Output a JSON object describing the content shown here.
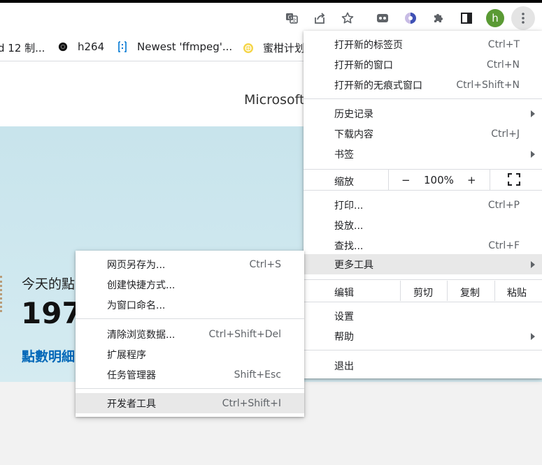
{
  "toolbar": {
    "icons": [
      "translate-icon",
      "share-icon",
      "bookmark-star-icon",
      "extension-game-icon",
      "extension-halo-icon",
      "extensions-puzzle-icon",
      "side-panel-icon",
      "profile-avatar",
      "kebab-menu-icon"
    ],
    "avatar_letter": "h",
    "avatar_color": "#5a9a34"
  },
  "bookmarks": [
    {
      "label": "d 12 制...",
      "icon": "none"
    },
    {
      "label": "h264",
      "icon": "dark-circle-icon"
    },
    {
      "label": "Newest 'ffmpeg'...",
      "icon": "stackoverflow-icon"
    },
    {
      "label": "蜜柑计划",
      "icon": "lemon-icon"
    }
  ],
  "page": {
    "header_title": "Microsoft",
    "today_label": "今天的點",
    "points_value": "197",
    "detail_link": "點數明細",
    "link_color": "#0067b8"
  },
  "main_menu": {
    "new_tab": {
      "label": "打开新的标签页",
      "shortcut": "Ctrl+T"
    },
    "new_window": {
      "label": "打开新的窗口",
      "shortcut": "Ctrl+N"
    },
    "incognito": {
      "label": "打开新的无痕式窗口",
      "shortcut": "Ctrl+Shift+N"
    },
    "history": {
      "label": "历史记录"
    },
    "downloads": {
      "label": "下载内容",
      "shortcut": "Ctrl+J"
    },
    "bookmarks": {
      "label": "书签"
    },
    "zoom": {
      "label": "缩放",
      "minus": "−",
      "value": "100%",
      "plus": "+"
    },
    "print": {
      "label": "打印...",
      "shortcut": "Ctrl+P"
    },
    "cast": {
      "label": "投放..."
    },
    "find": {
      "label": "查找...",
      "shortcut": "Ctrl+F"
    },
    "more_tools": {
      "label": "更多工具"
    },
    "edit": {
      "label": "编辑",
      "cut": "剪切",
      "copy": "复制",
      "paste": "粘贴"
    },
    "settings": {
      "label": "设置"
    },
    "help": {
      "label": "帮助"
    },
    "exit": {
      "label": "退出"
    }
  },
  "sub_menu": {
    "save_page": {
      "label": "网页另存为...",
      "shortcut": "Ctrl+S"
    },
    "create_shortcut": {
      "label": "创建快捷方式..."
    },
    "name_window": {
      "label": "为窗口命名..."
    },
    "clear_data": {
      "label": "清除浏览数据...",
      "shortcut": "Ctrl+Shift+Del"
    },
    "extensions": {
      "label": "扩展程序"
    },
    "task_manager": {
      "label": "任务管理器",
      "shortcut": "Shift+Esc"
    },
    "dev_tools": {
      "label": "开发者工具",
      "shortcut": "Ctrl+Shift+I"
    }
  }
}
